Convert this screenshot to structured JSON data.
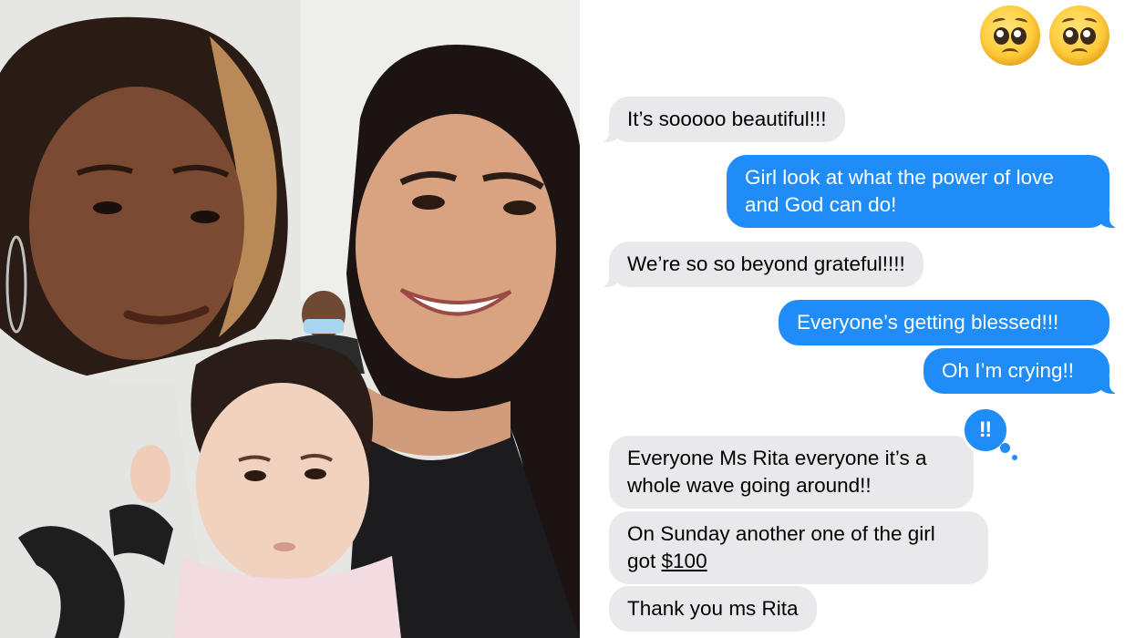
{
  "photo": {
    "alt": "Selfie of two smiling women holding a baby"
  },
  "header_reaction": {
    "emojis": [
      "pleading-face",
      "pleading-face"
    ]
  },
  "messages": [
    {
      "id": "m1",
      "direction": "incoming",
      "text": "It’s sooooo beautiful!!!"
    },
    {
      "id": "m2",
      "direction": "outgoing",
      "text": "Girl look at what the power of love\nand God can do!"
    },
    {
      "id": "m3",
      "direction": "incoming",
      "text": "We’re so so beyond grateful!!!!"
    },
    {
      "id": "m4",
      "direction": "outgoing",
      "text": "Everyone’s getting blessed!!!"
    },
    {
      "id": "m5",
      "direction": "outgoing",
      "text": "Oh I’m crying!!"
    },
    {
      "id": "m6",
      "direction": "incoming",
      "text": "Everyone Ms Rita everyone it’s a\nwhole wave going around!!"
    },
    {
      "id": "m7",
      "direction": "incoming",
      "text_before": "On Sunday another one of the girl\ngot ",
      "amount": "$100"
    },
    {
      "id": "m8",
      "direction": "incoming",
      "text": "Thank you ms Rita"
    }
  ],
  "tapback": {
    "symbol": "‼",
    "icon": "exclamation-tapback-icon"
  },
  "colors": {
    "incoming_bubble": "#e9e9eb",
    "outgoing_bubble": "#1f8cf7",
    "background": "#ffffff"
  }
}
